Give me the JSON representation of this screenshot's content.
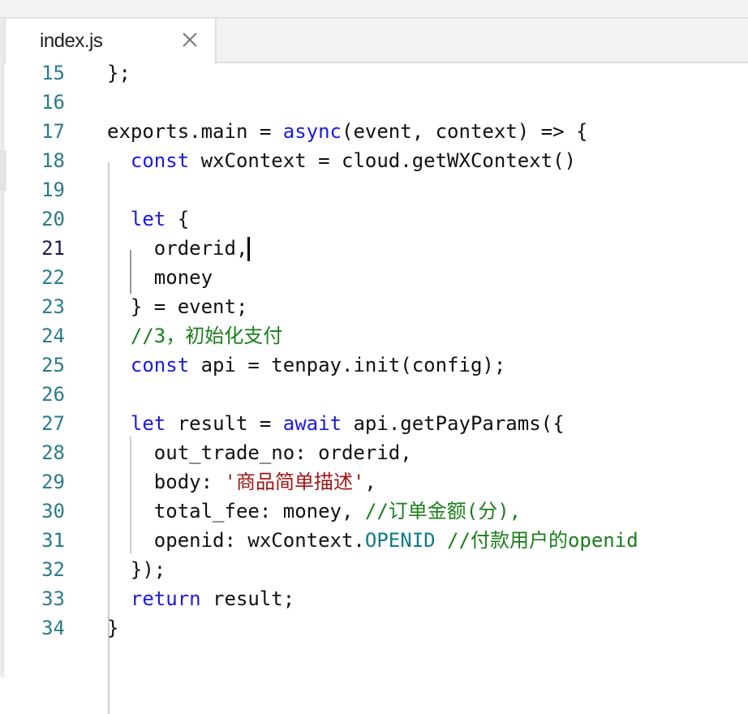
{
  "tab": {
    "label": "index.js",
    "close_icon": "close-icon"
  },
  "editor": {
    "active_line": 21,
    "colors": {
      "keyword": "#1a1ae0",
      "comment": "#1a7f1a",
      "string": "#a31515",
      "constant": "#0e7c86",
      "line_number": "#2b7b8c"
    },
    "lines": [
      {
        "n": "15",
        "tokens": [
          {
            "t": "};"
          }
        ]
      },
      {
        "n": "16",
        "tokens": []
      },
      {
        "n": "17",
        "tokens": [
          {
            "t": "exports.main = "
          },
          {
            "t": "async",
            "c": "kw"
          },
          {
            "t": "(event, context) => {"
          }
        ]
      },
      {
        "n": "18",
        "tokens": [
          {
            "t": "  "
          },
          {
            "t": "const",
            "c": "kw"
          },
          {
            "t": " wxContext = cloud.getWXContext()"
          }
        ]
      },
      {
        "n": "19",
        "tokens": []
      },
      {
        "n": "20",
        "tokens": [
          {
            "t": "  "
          },
          {
            "t": "let",
            "c": "kw"
          },
          {
            "t": " {"
          }
        ]
      },
      {
        "n": "21",
        "tokens": [
          {
            "t": "    orderid,"
          }
        ],
        "cursor": true
      },
      {
        "n": "22",
        "tokens": [
          {
            "t": "    money"
          }
        ]
      },
      {
        "n": "23",
        "tokens": [
          {
            "t": "  } = event;"
          }
        ]
      },
      {
        "n": "24",
        "tokens": [
          {
            "t": "  "
          },
          {
            "t": "//3，初始化支付",
            "c": "cm"
          }
        ]
      },
      {
        "n": "25",
        "tokens": [
          {
            "t": "  "
          },
          {
            "t": "const",
            "c": "kw"
          },
          {
            "t": " api = tenpay.init(config);"
          }
        ]
      },
      {
        "n": "26",
        "tokens": []
      },
      {
        "n": "27",
        "tokens": [
          {
            "t": "  "
          },
          {
            "t": "let",
            "c": "kw"
          },
          {
            "t": " result = "
          },
          {
            "t": "await",
            "c": "kw"
          },
          {
            "t": " api.getPayParams({"
          }
        ]
      },
      {
        "n": "28",
        "tokens": [
          {
            "t": "    out_trade_no: orderid,"
          }
        ]
      },
      {
        "n": "29",
        "tokens": [
          {
            "t": "    body: "
          },
          {
            "t": "'商品简单描述'",
            "c": "st"
          },
          {
            "t": ","
          }
        ]
      },
      {
        "n": "30",
        "tokens": [
          {
            "t": "    total_fee: money, "
          },
          {
            "t": "//订单金额(分),",
            "c": "cm"
          }
        ]
      },
      {
        "n": "31",
        "tokens": [
          {
            "t": "    openid: wxContext."
          },
          {
            "t": "OPENID",
            "c": "cn"
          },
          {
            "t": " "
          },
          {
            "t": "//付款用户的openid",
            "c": "cm"
          }
        ]
      },
      {
        "n": "32",
        "tokens": [
          {
            "t": "  });"
          }
        ]
      },
      {
        "n": "33",
        "tokens": [
          {
            "t": "  "
          },
          {
            "t": "return",
            "c": "kw"
          },
          {
            "t": " result;"
          }
        ]
      },
      {
        "n": "34",
        "tokens": [
          {
            "t": "}"
          }
        ]
      }
    ]
  }
}
